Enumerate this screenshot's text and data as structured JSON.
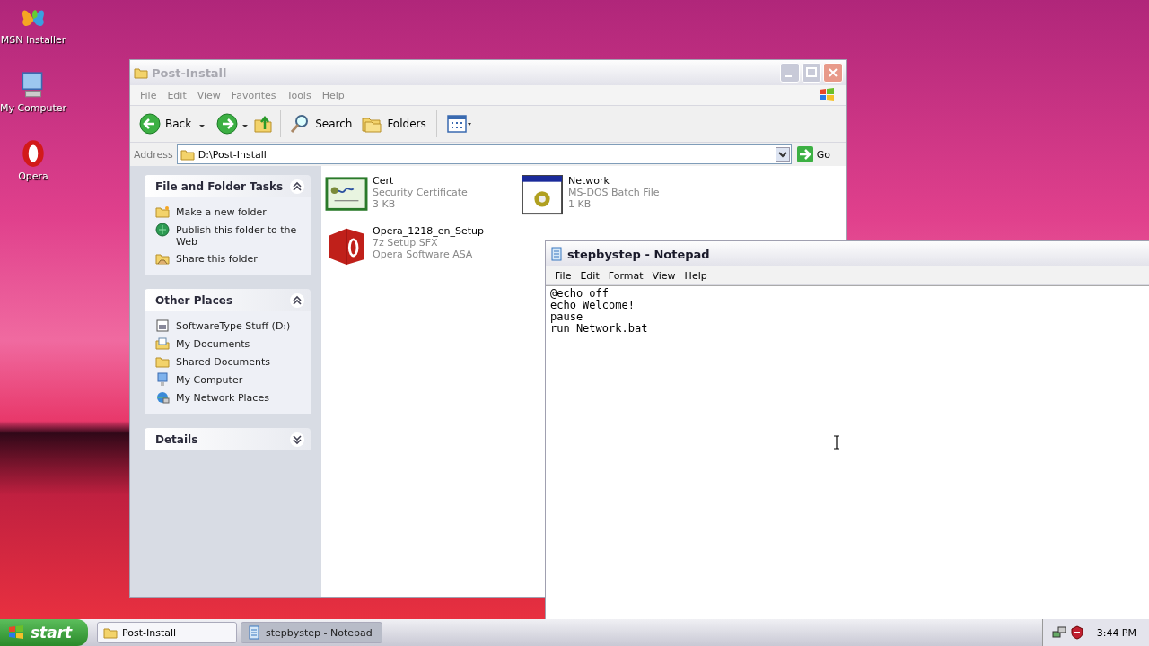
{
  "desktop_icons": [
    {
      "label": "MSN Installer",
      "kind": "butterfly"
    },
    {
      "label": "My Computer",
      "kind": "computer"
    },
    {
      "label": "Opera",
      "kind": "opera"
    }
  ],
  "explorer": {
    "title": "Post-Install",
    "active": false,
    "menu": [
      "File",
      "Edit",
      "View",
      "Favorites",
      "Tools",
      "Help"
    ],
    "toolbar": {
      "back": "Back",
      "search": "Search",
      "folders": "Folders"
    },
    "address": {
      "label": "Address",
      "value": "D:\\Post-Install",
      "go": "Go"
    },
    "panels": [
      {
        "title": "File and Folder Tasks",
        "expanded": true,
        "items": [
          {
            "label": "Make a new folder",
            "kind": "newfolder"
          },
          {
            "label": "Publish this folder to the Web",
            "kind": "globe"
          },
          {
            "label": "Share this folder",
            "kind": "share"
          }
        ]
      },
      {
        "title": "Other Places",
        "expanded": true,
        "items": [
          {
            "label": "SoftwareType Stuff (D:)",
            "kind": "drive"
          },
          {
            "label": "My Documents",
            "kind": "documents"
          },
          {
            "label": "Shared Documents",
            "kind": "folder"
          },
          {
            "label": "My Computer",
            "kind": "computer"
          },
          {
            "label": "My Network Places",
            "kind": "network"
          }
        ]
      },
      {
        "title": "Details",
        "expanded": false
      }
    ],
    "files": [
      {
        "name": "Cert",
        "type": "Security Certificate",
        "detail": "3 KB",
        "kind": "certificate"
      },
      {
        "name": "Network",
        "type": "MS-DOS Batch File",
        "detail": "1 KB",
        "kind": "batch"
      },
      {
        "name": "Opera_1218_en_Setup",
        "type": "7z Setup SFX",
        "detail": "Opera Software ASA",
        "kind": "installer"
      }
    ]
  },
  "notepad": {
    "title": "stepbystep - Notepad",
    "active": true,
    "menu": [
      "File",
      "Edit",
      "Format",
      "View",
      "Help"
    ],
    "text_lines": [
      "@echo off",
      "echo Welcome!",
      "pause",
      "run Network.bat"
    ]
  },
  "taskbar": {
    "start": "start",
    "tasks": [
      {
        "label": "Post-Install",
        "kind": "folder",
        "selected": false
      },
      {
        "label": "stepbystep - Notepad",
        "kind": "notepad",
        "selected": true
      }
    ],
    "clock": "3:44 PM"
  }
}
